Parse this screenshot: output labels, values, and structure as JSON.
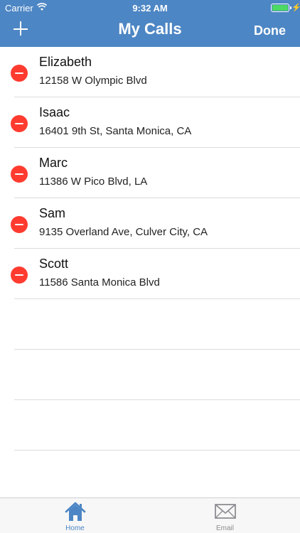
{
  "status": {
    "carrier": "Carrier",
    "time": "9:32 AM"
  },
  "navbar": {
    "title": "My Calls",
    "done_label": "Done"
  },
  "calls": [
    {
      "name": "Elizabeth",
      "address": "12158 W Olympic Blvd"
    },
    {
      "name": "Isaac",
      "address": "16401 9th St, Santa Monica, CA"
    },
    {
      "name": "Marc",
      "address": "11386 W Pico Blvd, LA"
    },
    {
      "name": "Sam",
      "address": "9135 Overland Ave, Culver City, CA"
    },
    {
      "name": "Scott",
      "address": "11586 Santa Monica Blvd"
    }
  ],
  "tabbar": {
    "tabs": [
      {
        "label": "Home",
        "icon": "home-icon",
        "selected": true
      },
      {
        "label": "Email",
        "icon": "envelope-icon",
        "selected": false
      }
    ]
  },
  "colors": {
    "header": "#4d86c4",
    "delete": "#ff3b30",
    "tab_selected": "#4d86c4",
    "tab_unselected": "#8e8e93"
  }
}
